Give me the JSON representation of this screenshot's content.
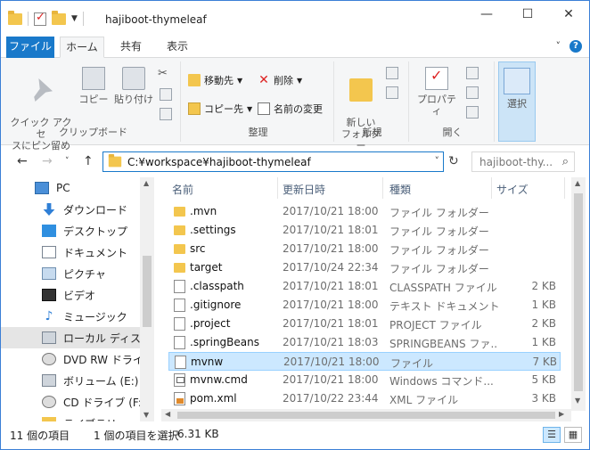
{
  "window": {
    "title": "hajiboot-thymeleaf"
  },
  "controls": {
    "minimize": "—",
    "maximize": "☐",
    "close": "✕",
    "expand": "˅",
    "help": "?"
  },
  "tabs": [
    {
      "label": "ファイル"
    },
    {
      "label": "ホーム"
    },
    {
      "label": "共有"
    },
    {
      "label": "表示"
    }
  ],
  "ribbon": {
    "clipboard": {
      "label": "クリップボード",
      "pin": "クイック アクセ\nスにピン留め",
      "copy": "コピー",
      "paste": "貼り付け"
    },
    "organize": {
      "label": "整理",
      "move": "移動先",
      "copyto": "コピー先",
      "delete": "削除",
      "rename": "名前の変更"
    },
    "new": {
      "label": "新規",
      "folder": "新しい\nフォルダー"
    },
    "open": {
      "label": "開く",
      "properties": "プロパティ"
    },
    "select": {
      "label": "選択"
    }
  },
  "address": {
    "path": "C:¥workspace¥hajiboot-thymeleaf",
    "search_placeholder": "hajiboot-thy..."
  },
  "nav_items": [
    {
      "label": "PC",
      "icon": "pc"
    },
    {
      "label": "ダウンロード",
      "icon": "down"
    },
    {
      "label": "デスクトップ",
      "icon": "desk"
    },
    {
      "label": "ドキュメント",
      "icon": "doc"
    },
    {
      "label": "ピクチャ",
      "icon": "pic"
    },
    {
      "label": "ビデオ",
      "icon": "vid"
    },
    {
      "label": "ミュージック",
      "icon": "music"
    },
    {
      "label": "ローカル ディスク (C",
      "icon": "disk",
      "selected": true
    },
    {
      "label": "DVD RW ドライブ (",
      "icon": "dvd"
    },
    {
      "label": "ボリューム (E:)",
      "icon": "disk"
    },
    {
      "label": "CD ドライブ (F:) W",
      "icon": "dvd"
    },
    {
      "label": "ライブラリ",
      "icon": "lib"
    }
  ],
  "columns": {
    "name": "名前",
    "date": "更新日時",
    "type": "種類",
    "size": "サイズ"
  },
  "files": [
    {
      "name": ".mvn",
      "date": "2017/10/21 18:00",
      "type": "ファイル フォルダー",
      "size": "",
      "icon": "folder"
    },
    {
      "name": ".settings",
      "date": "2017/10/21 18:01",
      "type": "ファイル フォルダー",
      "size": "",
      "icon": "folder"
    },
    {
      "name": "src",
      "date": "2017/10/21 18:00",
      "type": "ファイル フォルダー",
      "size": "",
      "icon": "folder"
    },
    {
      "name": "target",
      "date": "2017/10/24 22:34",
      "type": "ファイル フォルダー",
      "size": "",
      "icon": "folder"
    },
    {
      "name": ".classpath",
      "date": "2017/10/21 18:01",
      "type": "CLASSPATH ファイル",
      "size": "2 KB",
      "icon": "file"
    },
    {
      "name": ".gitignore",
      "date": "2017/10/21 18:00",
      "type": "テキスト ドキュメント",
      "size": "1 KB",
      "icon": "file"
    },
    {
      "name": ".project",
      "date": "2017/10/21 18:01",
      "type": "PROJECT ファイル",
      "size": "2 KB",
      "icon": "file"
    },
    {
      "name": ".springBeans",
      "date": "2017/10/21 18:03",
      "type": "SPRINGBEANS ファ...",
      "size": "1 KB",
      "icon": "file"
    },
    {
      "name": "mvnw",
      "date": "2017/10/21 18:00",
      "type": "ファイル",
      "size": "7 KB",
      "icon": "file",
      "selected": true
    },
    {
      "name": "mvnw.cmd",
      "date": "2017/10/21 18:00",
      "type": "Windows コマンド...",
      "size": "5 KB",
      "icon": "cmd"
    },
    {
      "name": "pom.xml",
      "date": "2017/10/22 23:44",
      "type": "XML ファイル",
      "size": "3 KB",
      "icon": "xml"
    }
  ],
  "status": {
    "count": "11 個の項目",
    "selection": "1 個の項目を選択",
    "size": "6.31 KB"
  }
}
